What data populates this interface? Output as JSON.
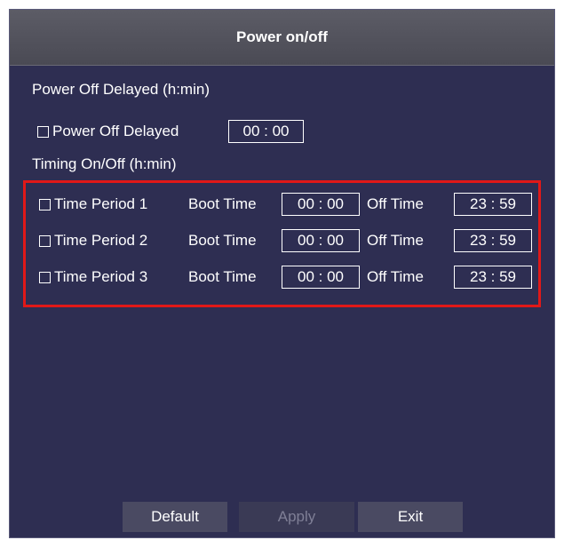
{
  "dialog": {
    "title": "Power on/off"
  },
  "power_off_delayed": {
    "section_label": "Power Off Delayed (h:min)",
    "checkbox_label": "Power Off Delayed",
    "checked": false,
    "value": "00 : 00"
  },
  "timing": {
    "section_label": "Timing On/Off (h:min)",
    "boot_label": "Boot Time",
    "off_label": "Off Time",
    "periods": [
      {
        "label": "Time Period 1",
        "checked": false,
        "boot": "00 : 00",
        "off": "23 : 59"
      },
      {
        "label": "Time Period 2",
        "checked": false,
        "boot": "00 : 00",
        "off": "23 : 59"
      },
      {
        "label": "Time Period 3",
        "checked": false,
        "boot": "00 : 00",
        "off": "23 : 59"
      }
    ]
  },
  "buttons": {
    "default": "Default",
    "apply": "Apply",
    "exit": "Exit"
  },
  "colors": {
    "panel_bg": "#2e2e52",
    "highlight": "#e01818",
    "disabled_text": "#7f7f96"
  }
}
